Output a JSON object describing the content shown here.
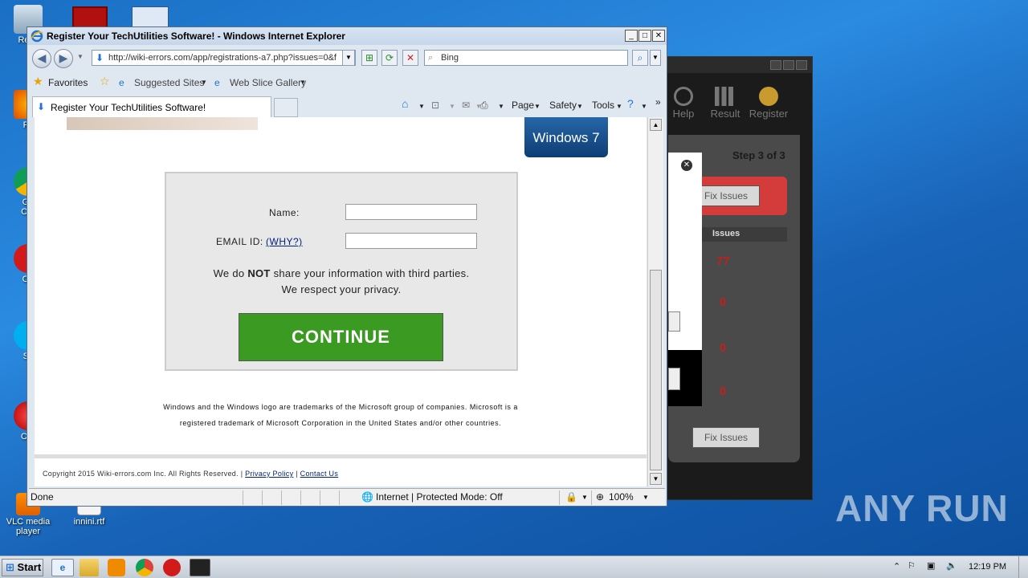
{
  "desktop": {
    "icons": [
      {
        "label": "Recy"
      },
      {
        "label": "Fir"
      },
      {
        "label": "Go"
      },
      {
        "label": "Chr"
      },
      {
        "label": "Op"
      },
      {
        "label": "Sk"
      },
      {
        "label": "CCl"
      },
      {
        "label": "VLC media player"
      },
      {
        "label": "innini.rtf"
      }
    ],
    "watermark": "ANY RUN"
  },
  "bg_app": {
    "tools": [
      "Help",
      "Result",
      "Register"
    ],
    "step": "Step 3 of 3",
    "fix_label": "Fix Issues",
    "issues_header": "Issues",
    "counts": [
      "77",
      "0",
      "0",
      "0"
    ],
    "fix_bottom_label": "Fix Issues"
  },
  "ie": {
    "title": "Register Your TechUtilities Software! - Windows Internet Explorer",
    "address": "http://wiki-errors.com/app/registrations-a7.php?issues=0&f",
    "search_placeholder": "Bing",
    "favorites_label": "Favorites",
    "suggested_label": "Suggested Sites",
    "slice_label": "Web Slice Gallery",
    "tab_title": "Register Your TechUtilities Software!",
    "cmd": {
      "page": "Page",
      "safety": "Safety",
      "tools": "Tools"
    },
    "status": {
      "left": "Done",
      "zone": "Internet | Protected Mode: Off",
      "zoom": "100%"
    }
  },
  "page": {
    "win7_label": "Windows 7",
    "form": {
      "name_label": "Name:",
      "email_label": "EMAIL ID:",
      "why_label": "(WHY?)",
      "notice_line1_pre": "We do ",
      "notice_line1_bold": "NOT",
      "notice_line1_post": " share your information with third parties.",
      "notice_line2": "We respect your privacy.",
      "continue_label": "CONTINUE"
    },
    "trademark_line1": "Windows and the Windows logo are trademarks of the Microsoft group of companies. Microsoft is a",
    "trademark_line2": "registered trademark of Microsoft Corporation in the United States and/or other countries.",
    "footer": {
      "copyright": "Copyright 2015 Wiki-errors.com Inc. All Rights Reserved.",
      "privacy": "Privacy Policy",
      "contact": "Contact Us"
    }
  },
  "taskbar": {
    "start_label": "Start",
    "clock": "12:19 PM"
  }
}
